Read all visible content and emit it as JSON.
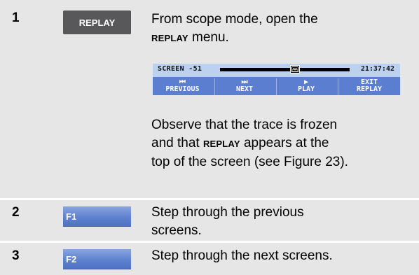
{
  "steps": [
    {
      "number": "1",
      "button_label": "REPLAY",
      "text_a": "From scope mode, open the",
      "text_b_keyword": "REPLAY",
      "text_b_rest": " menu.",
      "observe_1": "Observe that the trace is frozen",
      "observe_2_pre": "and that ",
      "observe_2_keyword": "REPLAY",
      "observe_2_post": " appears at the",
      "observe_3": "top of the screen (see Figure 23)."
    },
    {
      "number": "2",
      "button_label": "F1",
      "text_1": "Step through the previous",
      "text_2": "screens."
    },
    {
      "number": "3",
      "button_label": "F2",
      "text_1": "Step through the next screens."
    }
  ],
  "scope_screen": {
    "screen_label": "SCREEN -51",
    "time": "21:37:42",
    "buttons": [
      {
        "icon": "skip-previous-icon",
        "glyph": "⏮",
        "label_1": "PREVIOUS",
        "label_2": ""
      },
      {
        "icon": "skip-next-icon",
        "glyph": "⏭",
        "label_1": "NEXT",
        "label_2": ""
      },
      {
        "icon": "play-icon",
        "glyph": "▶",
        "label_1": "PLAY",
        "label_2": ""
      },
      {
        "icon": "",
        "glyph": "",
        "label_1": "EXIT",
        "label_2": "REPLAY"
      }
    ],
    "colors": {
      "strip_bg": "#5b7ed0",
      "top_bg": "#bcd0ef",
      "fkey_bg": "#5f82cf",
      "replay_button_bg": "#58585a",
      "row_bg": "#e6e6e6"
    }
  }
}
